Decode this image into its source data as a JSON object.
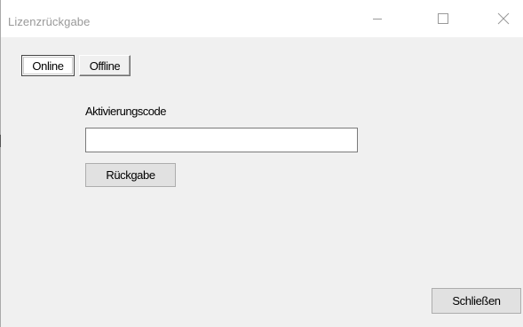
{
  "window": {
    "title": "Lizenzrückgabe",
    "controls": {
      "minimize_icon": "minimize-icon",
      "maximize_icon": "maximize-icon",
      "close_icon": "close-icon"
    }
  },
  "tabs": [
    {
      "label": "Online",
      "selected": true
    },
    {
      "label": "Offline",
      "selected": false
    }
  ],
  "form": {
    "activation_label": "Aktivierungscode",
    "activation_value": "",
    "return_button": "Rückgabe"
  },
  "footer": {
    "close_button": "Schließen"
  },
  "colors": {
    "window_bg": "#f0f0f0",
    "titlebar_bg": "#ffffff",
    "title_text": "#999999",
    "button_bg": "#e1e1e1",
    "button_border": "#adadad"
  }
}
